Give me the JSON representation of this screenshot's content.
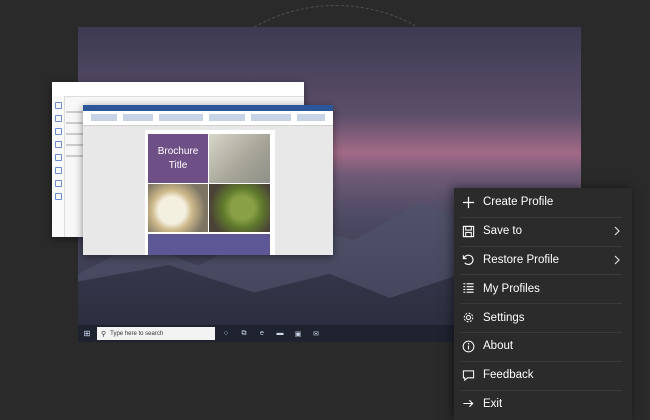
{
  "document": {
    "brochure_title_line1": "Brochure",
    "brochure_title_line2": "Title"
  },
  "taskbar": {
    "search_placeholder": "Type here to search"
  },
  "menu": {
    "items": [
      {
        "label": "Create Profile",
        "icon": "plus-icon",
        "submenu": false
      },
      {
        "label": "Save to",
        "icon": "save-icon",
        "submenu": true
      },
      {
        "label": "Restore Profile",
        "icon": "restore-icon",
        "submenu": true
      },
      {
        "label": "My Profiles",
        "icon": "list-icon",
        "submenu": false
      },
      {
        "label": "Settings",
        "icon": "gear-icon",
        "submenu": false
      },
      {
        "label": "About",
        "icon": "info-icon",
        "submenu": false
      },
      {
        "label": "Feedback",
        "icon": "feedback-icon",
        "submenu": false
      },
      {
        "label": "Exit",
        "icon": "exit-arrow-icon",
        "submenu": false
      }
    ]
  },
  "colors": {
    "menu_background": "#2b2b2b",
    "menu_text": "#ffffff",
    "brochure_purple": "#6e4f86",
    "word_blue": "#2b579a"
  }
}
